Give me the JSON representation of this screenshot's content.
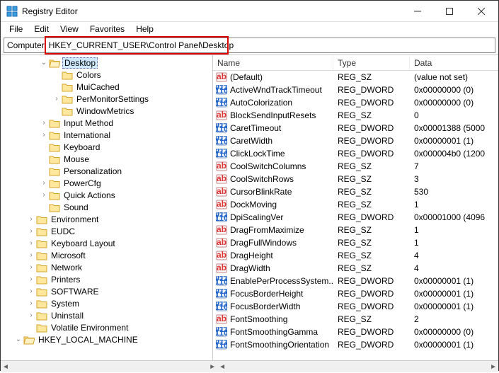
{
  "window": {
    "title": "Registry Editor"
  },
  "menubar": [
    "File",
    "Edit",
    "View",
    "Favorites",
    "Help"
  ],
  "addressbar": {
    "label": "Computer",
    "path": "HKEY_CURRENT_USER\\Control Panel\\Desktop"
  },
  "tree": [
    {
      "indent": 3,
      "expander": "v",
      "open": true,
      "label": "Desktop",
      "selected": true
    },
    {
      "indent": 4,
      "expander": "",
      "label": "Colors"
    },
    {
      "indent": 4,
      "expander": "",
      "label": "MuiCached"
    },
    {
      "indent": 4,
      "expander": ">",
      "label": "PerMonitorSettings"
    },
    {
      "indent": 4,
      "expander": "",
      "label": "WindowMetrics"
    },
    {
      "indent": 3,
      "expander": ">",
      "label": "Input Method"
    },
    {
      "indent": 3,
      "expander": ">",
      "label": "International"
    },
    {
      "indent": 3,
      "expander": "",
      "label": "Keyboard"
    },
    {
      "indent": 3,
      "expander": "",
      "label": "Mouse"
    },
    {
      "indent": 3,
      "expander": "",
      "label": "Personalization"
    },
    {
      "indent": 3,
      "expander": ">",
      "label": "PowerCfg"
    },
    {
      "indent": 3,
      "expander": ">",
      "label": "Quick Actions"
    },
    {
      "indent": 3,
      "expander": "",
      "label": "Sound"
    },
    {
      "indent": 2,
      "expander": ">",
      "label": "Environment"
    },
    {
      "indent": 2,
      "expander": ">",
      "label": "EUDC"
    },
    {
      "indent": 2,
      "expander": ">",
      "label": "Keyboard Layout"
    },
    {
      "indent": 2,
      "expander": ">",
      "label": "Microsoft"
    },
    {
      "indent": 2,
      "expander": ">",
      "label": "Network"
    },
    {
      "indent": 2,
      "expander": ">",
      "label": "Printers"
    },
    {
      "indent": 2,
      "expander": ">",
      "label": "SOFTWARE"
    },
    {
      "indent": 2,
      "expander": ">",
      "label": "System"
    },
    {
      "indent": 2,
      "expander": ">",
      "label": "Uninstall"
    },
    {
      "indent": 2,
      "expander": "",
      "label": "Volatile Environment"
    },
    {
      "indent": 1,
      "expander": "v",
      "open": true,
      "label": "HKEY_LOCAL_MACHINE"
    }
  ],
  "columns": [
    "Name",
    "Type",
    "Data"
  ],
  "values": [
    {
      "icon": "sz",
      "name": "(Default)",
      "type": "REG_SZ",
      "data": "(value not set)"
    },
    {
      "icon": "dw",
      "name": "ActiveWndTrackTimeout",
      "type": "REG_DWORD",
      "data": "0x00000000 (0)"
    },
    {
      "icon": "dw",
      "name": "AutoColorization",
      "type": "REG_DWORD",
      "data": "0x00000000 (0)"
    },
    {
      "icon": "sz",
      "name": "BlockSendInputResets",
      "type": "REG_SZ",
      "data": "0"
    },
    {
      "icon": "dw",
      "name": "CaretTimeout",
      "type": "REG_DWORD",
      "data": "0x00001388 (5000"
    },
    {
      "icon": "dw",
      "name": "CaretWidth",
      "type": "REG_DWORD",
      "data": "0x00000001 (1)"
    },
    {
      "icon": "dw",
      "name": "ClickLockTime",
      "type": "REG_DWORD",
      "data": "0x000004b0 (1200"
    },
    {
      "icon": "sz",
      "name": "CoolSwitchColumns",
      "type": "REG_SZ",
      "data": "7"
    },
    {
      "icon": "sz",
      "name": "CoolSwitchRows",
      "type": "REG_SZ",
      "data": "3"
    },
    {
      "icon": "sz",
      "name": "CursorBlinkRate",
      "type": "REG_SZ",
      "data": "530"
    },
    {
      "icon": "sz",
      "name": "DockMoving",
      "type": "REG_SZ",
      "data": "1"
    },
    {
      "icon": "dw",
      "name": "DpiScalingVer",
      "type": "REG_DWORD",
      "data": "0x00001000 (4096"
    },
    {
      "icon": "sz",
      "name": "DragFromMaximize",
      "type": "REG_SZ",
      "data": "1"
    },
    {
      "icon": "sz",
      "name": "DragFullWindows",
      "type": "REG_SZ",
      "data": "1"
    },
    {
      "icon": "sz",
      "name": "DragHeight",
      "type": "REG_SZ",
      "data": "4"
    },
    {
      "icon": "sz",
      "name": "DragWidth",
      "type": "REG_SZ",
      "data": "4"
    },
    {
      "icon": "dw",
      "name": "EnablePerProcessSystem...",
      "type": "REG_DWORD",
      "data": "0x00000001 (1)"
    },
    {
      "icon": "dw",
      "name": "FocusBorderHeight",
      "type": "REG_DWORD",
      "data": "0x00000001 (1)"
    },
    {
      "icon": "dw",
      "name": "FocusBorderWidth",
      "type": "REG_DWORD",
      "data": "0x00000001 (1)"
    },
    {
      "icon": "sz",
      "name": "FontSmoothing",
      "type": "REG_SZ",
      "data": "2"
    },
    {
      "icon": "dw",
      "name": "FontSmoothingGamma",
      "type": "REG_DWORD",
      "data": "0x00000000 (0)"
    },
    {
      "icon": "dw",
      "name": "FontSmoothingOrientation",
      "type": "REG_DWORD",
      "data": "0x00000001 (1)"
    }
  ]
}
